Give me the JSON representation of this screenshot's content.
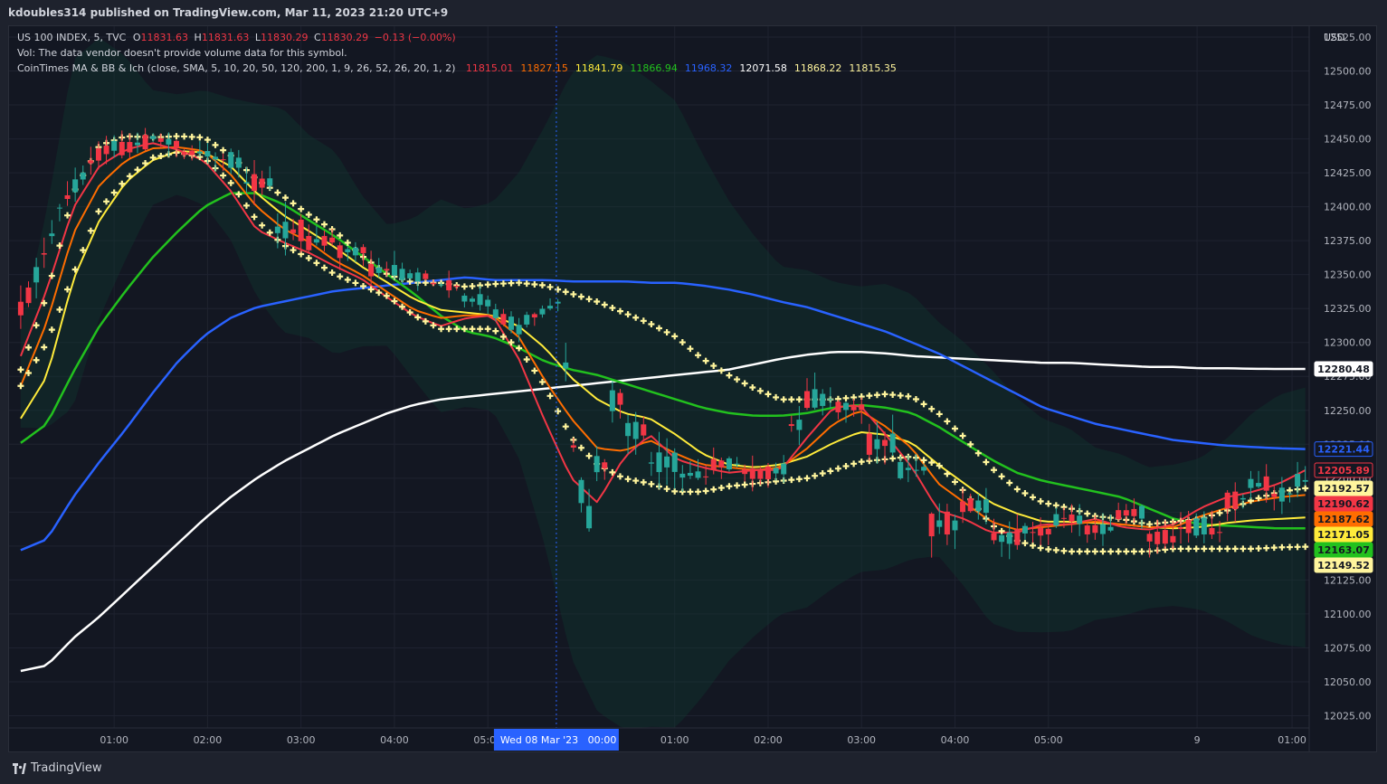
{
  "header": {
    "publisher": "kdoubles314 published on TradingView.com, Mar 11, 2023 21:20 UTC+9"
  },
  "legend": {
    "symbol": "US 100 INDEX, 5, TVC",
    "o_label": "O",
    "o_value": "11831.63",
    "h_label": "H",
    "h_value": "11831.63",
    "l_label": "L",
    "l_value": "11830.29",
    "c_label": "C",
    "c_value": "11830.29",
    "change": "−0.13 (−0.00%)",
    "vol_text": "Vol: The data vendor doesn't provide volume data for this symbol.",
    "indicator": "CoinTimes MA & BB & Ich (close, SMA, 5, 10, 20, 50, 120, 200, 1, 9, 26, 52, 26, 20, 1, 2)",
    "indicator_values": [
      {
        "value": "11815.01",
        "color": "#f23645"
      },
      {
        "value": "11827.15",
        "color": "#ff6d00"
      },
      {
        "value": "11841.79",
        "color": "#ffeb3b"
      },
      {
        "value": "11866.94",
        "color": "#22c11e"
      },
      {
        "value": "11968.32",
        "color": "#2962ff"
      },
      {
        "value": "12071.58",
        "color": "#ffffff"
      },
      {
        "value": "11868.22",
        "color": "#fff59d"
      },
      {
        "value": "11815.35",
        "color": "#fff59d"
      }
    ]
  },
  "crosshair_label": "Wed 08 Mar '23   00:00",
  "currency": "USD",
  "footer": {
    "logo_text": "TradingView"
  },
  "colors": {
    "background": "#131722",
    "up_candle": "#26a69a",
    "down_candle": "#f23645",
    "ma5": "#f23645",
    "ma10": "#ff6d00",
    "ma20": "#ffeb3b",
    "ma50": "#22c11e",
    "ma120": "#2962ff",
    "ma200": "#ffffff",
    "bands": "#fff59d",
    "crosshair": "#2962ff"
  },
  "chart_data": {
    "type": "candlestick",
    "symbol": "US 100 INDEX",
    "interval": "5",
    "ylim": [
      12016,
      12533
    ],
    "y_ticks": [
      12025,
      12050,
      12075,
      12100,
      12125,
      12150,
      12175,
      12200,
      12225,
      12250,
      12275,
      12300,
      12325,
      12350,
      12375,
      12400,
      12425,
      12450,
      12475,
      12500,
      12525
    ],
    "x_ticks": [
      {
        "label": "01:00",
        "x": 12.0
      },
      {
        "label": "02:00",
        "x": 24.0
      },
      {
        "label": "03:00",
        "x": 36.0
      },
      {
        "label": "04:00",
        "x": 48.0
      },
      {
        "label": "05:00",
        "x": 60.0
      },
      {
        "label": "01:00",
        "x": 84.0
      },
      {
        "label": "02:00",
        "x": 96.0
      },
      {
        "label": "03:00",
        "x": 108.0
      },
      {
        "label": "04:00",
        "x": 120.0
      },
      {
        "label": "05:00",
        "x": 132.0
      },
      {
        "label": "9",
        "x": 151.1
      },
      {
        "label": "01:00",
        "x": 163.3
      }
    ],
    "xlim": [
      -1.5,
      165.5
    ],
    "crosshair_x": 68.8,
    "keys": [
      [
        0,
        12330,
        12342,
        12310,
        12320
      ],
      [
        4,
        12380,
        12395,
        12368,
        12392
      ],
      [
        8,
        12422,
        12440,
        12412,
        12430
      ],
      [
        12,
        12445,
        12458,
        12430,
        12440
      ],
      [
        16,
        12448,
        12462,
        12440,
        12452
      ],
      [
        20,
        12446,
        12452,
        12434,
        12440
      ],
      [
        24,
        12440,
        12450,
        12428,
        12438
      ],
      [
        28,
        12432,
        12440,
        12410,
        12418
      ],
      [
        32,
        12418,
        12422,
        12376,
        12382
      ],
      [
        36,
        12382,
        12392,
        12360,
        12372
      ],
      [
        40,
        12376,
        12386,
        12358,
        12366
      ],
      [
        44,
        12368,
        12378,
        12346,
        12354
      ],
      [
        48,
        12354,
        12362,
        12342,
        12350
      ],
      [
        52,
        12348,
        12356,
        12336,
        12344
      ],
      [
        56,
        12342,
        12350,
        12326,
        12334
      ],
      [
        60,
        12330,
        12338,
        12316,
        12326
      ],
      [
        64,
        12310,
        12322,
        12302,
        12314
      ],
      [
        68,
        12326,
        12336,
        12320,
        12330
      ],
      [
        69,
        12330,
        12334,
        12270,
        12284
      ],
      [
        70,
        12284,
        12296,
        12215,
        12224
      ],
      [
        71,
        12224,
        12240,
        12170,
        12190
      ],
      [
        72,
        12190,
        12210,
        12160,
        12172
      ],
      [
        73,
        12172,
        12215,
        12168,
        12210
      ],
      [
        75,
        12210,
        12268,
        12200,
        12258
      ],
      [
        77,
        12258,
        12270,
        12230,
        12236
      ],
      [
        80,
        12236,
        12248,
        12200,
        12212
      ],
      [
        84,
        12212,
        12226,
        12196,
        12202
      ],
      [
        88,
        12202,
        12218,
        12196,
        12210
      ],
      [
        92,
        12210,
        12222,
        12196,
        12204
      ],
      [
        96,
        12204,
        12212,
        12198,
        12206
      ],
      [
        98,
        12206,
        12250,
        12200,
        12240
      ],
      [
        100,
        12240,
        12268,
        12232,
        12258
      ],
      [
        104,
        12258,
        12270,
        12244,
        12252
      ],
      [
        108,
        12252,
        12260,
        12220,
        12226
      ],
      [
        112,
        12226,
        12232,
        12200,
        12206
      ],
      [
        116,
        12206,
        12210,
        12160,
        12166
      ],
      [
        120,
        12166,
        12186,
        12160,
        12180
      ],
      [
        124,
        12180,
        12186,
        12148,
        12156
      ],
      [
        128,
        12156,
        12168,
        12146,
        12162
      ],
      [
        132,
        12160,
        12174,
        12150,
        12170
      ],
      [
        136,
        12170,
        12178,
        12154,
        12162
      ],
      [
        140,
        12162,
        12178,
        12158,
        12174
      ],
      [
        144,
        12174,
        12182,
        12148,
        12156
      ],
      [
        148,
        12156,
        12172,
        12140,
        12164
      ],
      [
        152,
        12164,
        12180,
        12140,
        12160
      ],
      [
        154,
        12160,
        12190,
        12156,
        12184
      ],
      [
        157,
        12184,
        12206,
        12174,
        12196
      ],
      [
        160,
        12196,
        12208,
        12178,
        12188
      ],
      [
        163,
        12188,
        12214,
        12182,
        12198
      ],
      [
        165,
        12198,
        12210,
        12190,
        12202
      ]
    ],
    "series": [
      {
        "name": "MA5",
        "key": "ma5",
        "values": [
          12290,
          12339,
          12399,
          12430,
          12442,
          12447,
          12442,
          12434,
          12412,
          12383,
          12374,
          12366,
          12356,
          12347,
          12333,
          12320,
          12312,
          12318,
          12320,
          12288,
          12242,
          12200,
          12182,
          12215,
          12232,
          12214,
          12208,
          12204,
          12206,
          12206,
          12230,
          12252,
          12254,
          12232,
          12208,
          12176,
          12170,
          12160,
          12160,
          12166,
          12166,
          12170,
          12164,
          12162,
          12166,
          12178,
          12186,
          12190,
          12196,
          12205.89
        ]
      },
      {
        "name": "MA10",
        "key": "ma10",
        "values": [
          12268,
          12315,
          12380,
          12416,
          12434,
          12443,
          12444,
          12441,
          12424,
          12400,
          12384,
          12374,
          12360,
          12350,
          12337,
          12324,
          12318,
          12320,
          12320,
          12304,
          12272,
          12244,
          12222,
          12220,
          12228,
          12218,
          12210,
          12208,
          12206,
          12208,
          12222,
          12240,
          12250,
          12238,
          12222,
          12196,
          12182,
          12168,
          12162,
          12164,
          12166,
          12168,
          12166,
          12164,
          12164,
          12172,
          12178,
          12183,
          12186,
          12187.62
        ]
      },
      {
        "name": "MA20",
        "key": "ma20",
        "values": [
          12244,
          12275,
          12346,
          12390,
          12418,
          12434,
          12441,
          12440,
          12430,
          12410,
          12394,
          12382,
          12370,
          12356,
          12344,
          12332,
          12324,
          12322,
          12320,
          12312,
          12296,
          12274,
          12258,
          12248,
          12244,
          12232,
          12218,
          12210,
          12208,
          12210,
          12216,
          12226,
          12234,
          12232,
          12226,
          12210,
          12196,
          12182,
          12174,
          12168,
          12168,
          12167,
          12166,
          12164,
          12163,
          12164,
          12167,
          12169,
          12170,
          12171.05
        ]
      },
      {
        "name": "MA50",
        "key": "ma50",
        "values": [
          12226,
          12240,
          12278,
          12312,
          12338,
          12362,
          12382,
          12400,
          12410,
          12410,
          12402,
          12390,
          12378,
          12364,
          12350,
          12336,
          12320,
          12308,
          12304,
          12296,
          12286,
          12280,
          12276,
          12270,
          12264,
          12258,
          12252,
          12248,
          12246,
          12246,
          12248,
          12252,
          12254,
          12252,
          12248,
          12238,
          12226,
          12214,
          12204,
          12198,
          12194,
          12190,
          12186,
          12178,
          12170,
          12166,
          12165,
          12164,
          12163,
          12163.07
        ]
      },
      {
        "name": "MA120",
        "key": "ma120",
        "values": [
          12147,
          12155,
          12186,
          12212,
          12236,
          12262,
          12286,
          12305,
          12318,
          12326,
          12330,
          12334,
          12338,
          12340,
          12342,
          12344,
          12346,
          12348,
          12346,
          12346,
          12346,
          12345,
          12345,
          12345,
          12344,
          12344,
          12342,
          12339,
          12335,
          12330,
          12326,
          12320,
          12314,
          12308,
          12300,
          12292,
          12282,
          12272,
          12262,
          12252,
          12246,
          12240,
          12236,
          12232,
          12228,
          12226,
          12224,
          12223,
          12222,
          12221.44
        ]
      },
      {
        "name": "MA200",
        "key": "ma200",
        "values": [
          12058,
          12062,
          12082,
          12098,
          12116,
          12134,
          12152,
          12170,
          12186,
          12200,
          12212,
          12222,
          12232,
          12240,
          12248,
          12254,
          12258,
          12260,
          12262,
          12264,
          12266,
          12268,
          12270,
          12272,
          12274,
          12276,
          12278,
          12280,
          12284,
          12288,
          12291,
          12293,
          12293,
          12292,
          12290,
          12289,
          12288,
          12287,
          12286,
          12285,
          12285,
          12284,
          12283,
          12282,
          12282,
          12281,
          12281,
          12280.6,
          12280.5,
          12280.48
        ]
      },
      {
        "name": "BB Upper",
        "key": "bb_up",
        "values": [
          12280,
          12335,
          12410,
          12445,
          12452,
          12451,
          12452,
          12451,
          12438,
          12420,
          12408,
          12394,
          12382,
          12364,
          12350,
          12344,
          12344,
          12341,
          12343,
          12344,
          12342,
          12336,
          12330,
          12322,
          12314,
          12304,
          12288,
          12276,
          12266,
          12258,
          12258,
          12258,
          12260,
          12262,
          12260,
          12248,
          12230,
          12208,
          12192,
          12182,
          12178,
          12172,
          12170,
          12166,
          12168,
          12170,
          12176,
          12184,
          12190,
          12192.57
        ]
      },
      {
        "name": "BB Lower",
        "key": "bb_low",
        "values": [
          12268,
          12300,
          12350,
          12398,
          12420,
          12436,
          12440,
          12436,
          12418,
          12390,
          12372,
          12362,
          12350,
          12342,
          12334,
          12320,
          12310,
          12310,
          12310,
          12296,
          12268,
          12230,
          12210,
          12200,
          12196,
          12190,
          12190,
          12194,
          12196,
          12198,
          12200,
          12206,
          12212,
          12214,
          12216,
          12210,
          12190,
          12166,
          12154,
          12148,
          12146,
          12146,
          12146,
          12146,
          12148,
          12148,
          12148,
          12148,
          12149,
          12149.52
        ]
      }
    ],
    "price_labels": [
      {
        "value": "12280.48",
        "price": 12280.48,
        "bg": "#ffffff",
        "fg": "#131722",
        "border": "#ffffff"
      },
      {
        "value": "12221.44",
        "price": 12221.44,
        "bg": "#131722",
        "fg": "#2962ff",
        "border": "#2962ff"
      },
      {
        "value": "12205.89",
        "price": 12205.89,
        "bg": "#131722",
        "fg": "#f23645",
        "border": "#f23645"
      },
      {
        "value": "12192.57",
        "price": 12192.57,
        "bg": "#fff59d",
        "fg": "#131722",
        "border": "#fff59d"
      },
      {
        "value": "12190.62",
        "price": 12190.62,
        "bg": "#f23645",
        "fg": "#131722",
        "border": "#f23645"
      },
      {
        "value": "12187.62",
        "price": 12187.62,
        "bg": "#ff6d00",
        "fg": "#131722",
        "border": "#ff6d00"
      },
      {
        "value": "12171.05",
        "price": 12171.05,
        "bg": "#ffeb3b",
        "fg": "#131722",
        "border": "#ffeb3b"
      },
      {
        "value": "12163.07",
        "price": 12163.07,
        "bg": "#22c11e",
        "fg": "#131722",
        "border": "#22c11e"
      },
      {
        "value": "12149.52",
        "price": 12149.52,
        "bg": "#fff59d",
        "fg": "#131722",
        "border": "#fff59d"
      }
    ]
  }
}
